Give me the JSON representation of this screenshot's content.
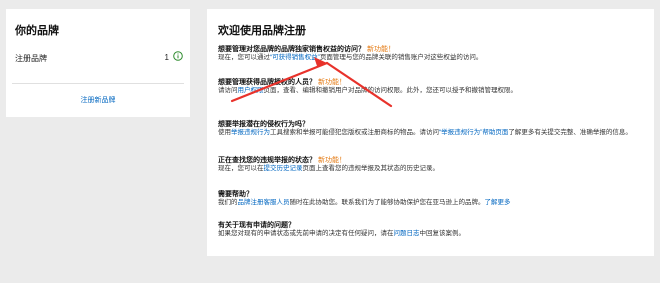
{
  "left_panel": {
    "title": "你的品牌",
    "registered_label": "注册品牌",
    "registered_count": "1",
    "register_link": "注册新品牌"
  },
  "right_panel": {
    "title": "欢迎使用品牌注册",
    "sections": [
      {
        "title": "想要管理对您品牌的品牌独家销售权益的访问？",
        "badge": "新功能！",
        "body_prefix": "现在，您可以通过",
        "link": "“可获得销售权益”",
        "body_suffix": "页面管理与您的品牌关联的销售账户对这些权益的访问。"
      },
      {
        "title": "想要管理获得品牌授权的人员？",
        "badge": "新功能！",
        "body_prefix": "请访问",
        "link": "用户权限",
        "body_suffix": "页面，查看、编辑和撤销用户对品牌的访问权限。此外，您还可以授予和撤销管理权限。"
      },
      {
        "title": "想要举报潜在的侵权行为吗？",
        "body_prefix": "使用",
        "link": "举报违规行为",
        "body_middle": "工具搜索和举报可能侵犯您版权或注册商标的物品。请访问",
        "link2": "“举报违规行为”帮助页面",
        "body_suffix": "了解更多有关提交完整、准确举报的信息。"
      },
      {
        "title": "正在查找您的违规举报的状态？",
        "badge": "新功能！",
        "body_prefix": "现在，您可以在",
        "link": "提交历史记录",
        "body_suffix": "页面上查看您的违规举报及其状态的历史记录。"
      },
      {
        "title": "需要帮助？",
        "body_prefix": "我们的",
        "link": "品牌注册客服人员",
        "body_middle": "随时在此协助您。联系我们为了能够协助保护您在亚马逊上的品牌。",
        "link2": "了解更多"
      },
      {
        "title": "有关于现有申请的问题？",
        "body_prefix": "如果您对现有的申请状态或先前申请的决定有任何疑问，请在",
        "link": "问题日志",
        "body_suffix": "中回复该案例。"
      }
    ]
  },
  "colors": {
    "link": "#0066c0",
    "badge": "#e47911",
    "annotation_arrow": "#e8322b"
  },
  "icons": {
    "info": "info-circle-icon"
  }
}
